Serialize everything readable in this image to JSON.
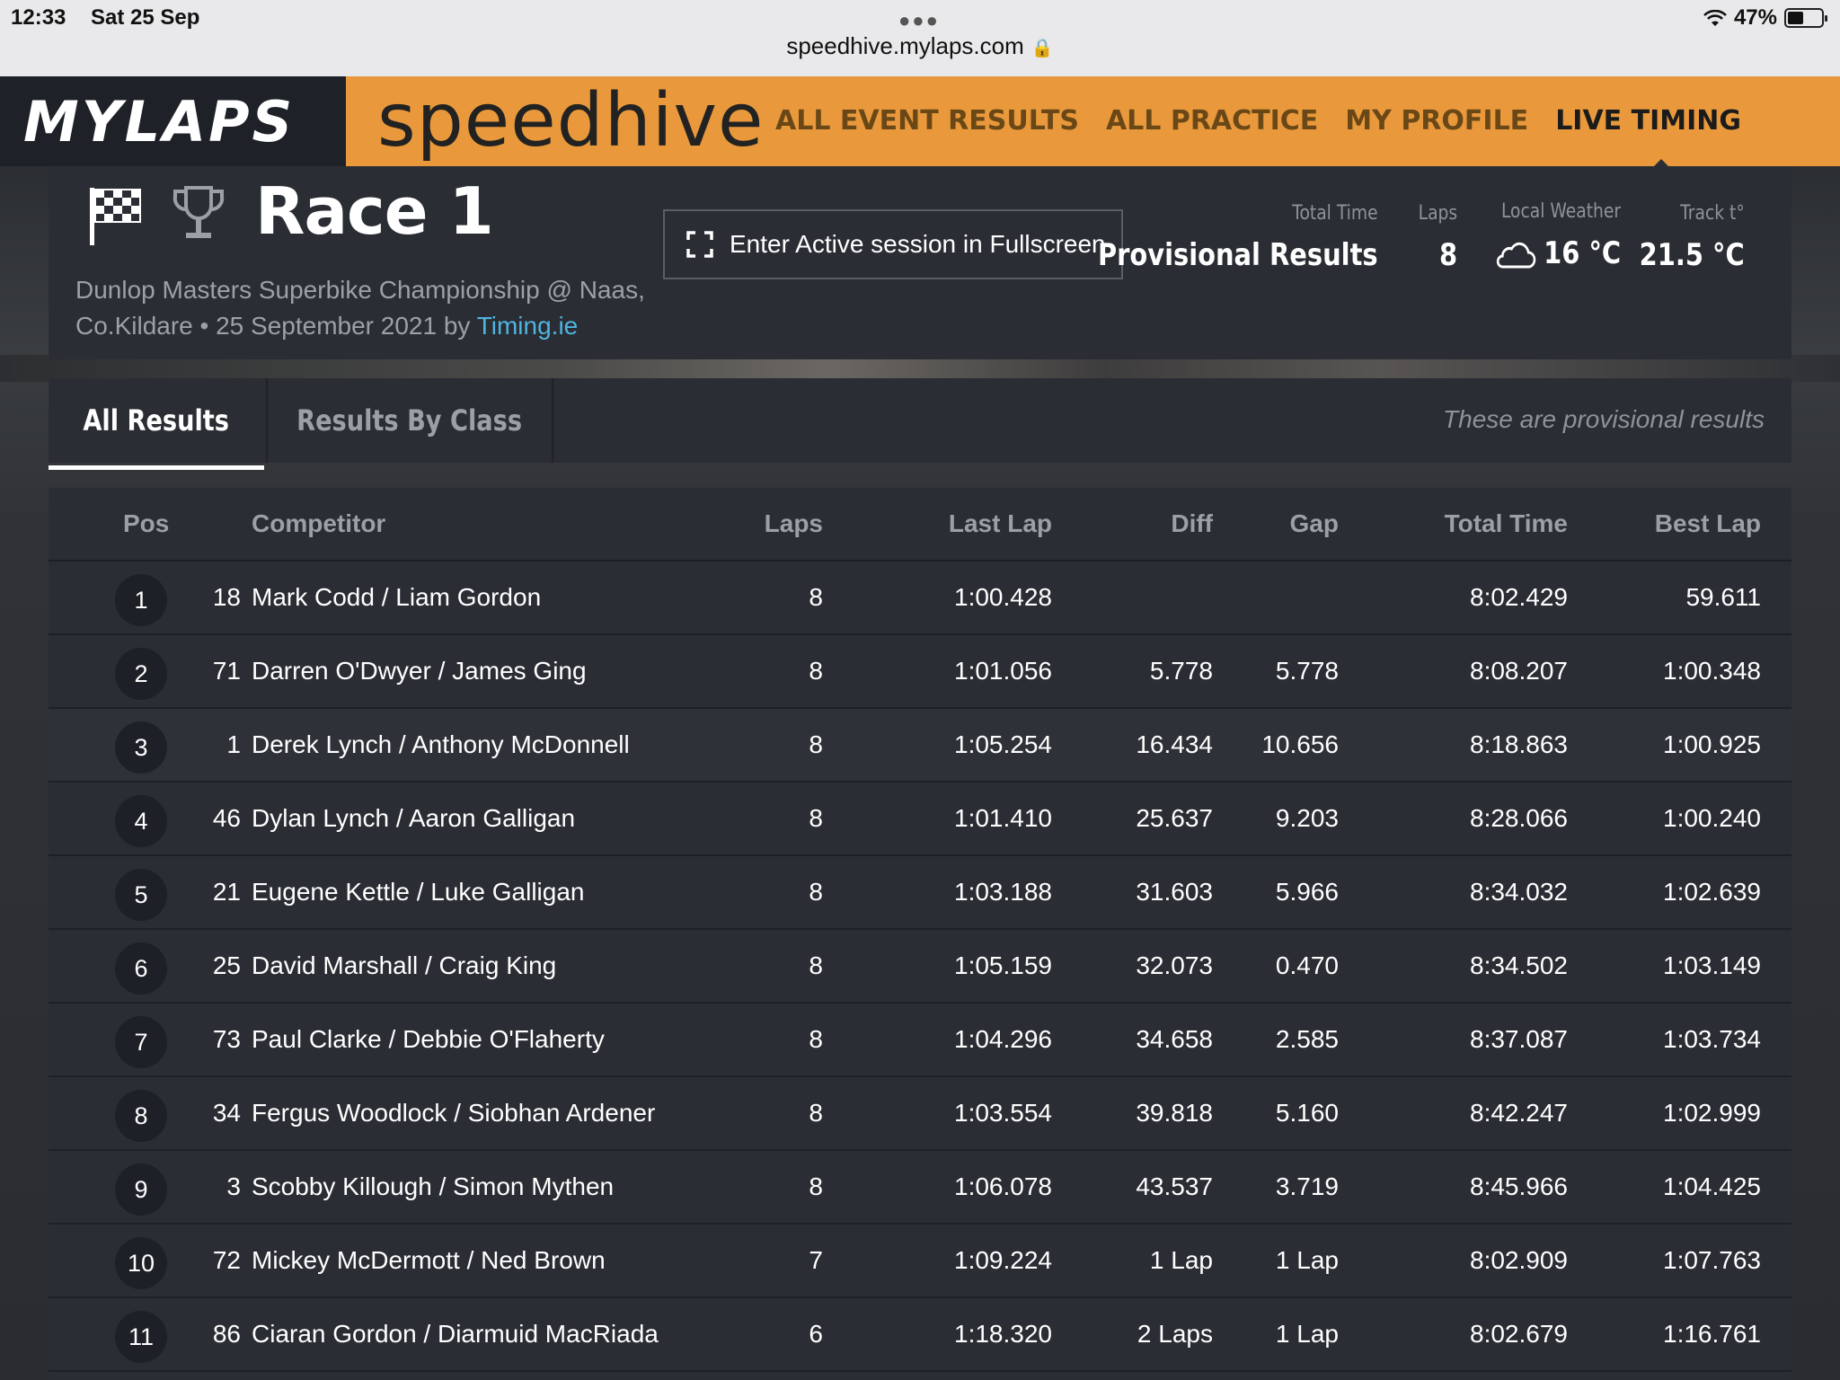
{
  "status_bar": {
    "time": "12:33",
    "date": "Sat 25 Sep",
    "url": "speedhive.mylaps.com",
    "battery": "47%",
    "battery_level": 0.47
  },
  "header": {
    "brand_left": "MYLAPS",
    "brand_right": "speedhive",
    "nav": [
      "ALL EVENT RESULTS",
      "ALL PRACTICE",
      "MY PROFILE",
      "LIVE TIMING"
    ],
    "active_nav": "LIVE TIMING",
    "accent_color": "#e9993b"
  },
  "race": {
    "title": "Race 1",
    "subtitle": "Dunlop Masters Superbike Championship @ Naas, Co.Kildare • 25 September 2021 by",
    "organizer_link": "Timing.ie",
    "fullscreen_button": "Enter Active session in Fullscreen",
    "stats": {
      "total_time_label": "Total Time",
      "total_time_value": "Provisional Results",
      "laps_label": "Laps",
      "laps_value": "8",
      "weather_label": "Local Weather",
      "weather_value": "16 °C",
      "track_label": "Track t°",
      "track_value": "21.5 °C"
    }
  },
  "tabs": {
    "all": "All Results",
    "by_class": "Results By Class",
    "note": "These are provisional results"
  },
  "table": {
    "columns": {
      "pos": "Pos",
      "competitor": "Competitor",
      "laps": "Laps",
      "last_lap": "Last Lap",
      "diff": "Diff",
      "gap": "Gap",
      "total_time": "Total Time",
      "best_lap": "Best Lap"
    },
    "rows": [
      {
        "pos": "1",
        "num": "18",
        "name": "Mark Codd / Liam Gordon",
        "laps": "8",
        "last": "1:00.428",
        "diff": "",
        "gap": "",
        "total": "8:02.429",
        "best": "59.611"
      },
      {
        "pos": "2",
        "num": "71",
        "name": "Darren O'Dwyer / James Ging",
        "laps": "8",
        "last": "1:01.056",
        "diff": "5.778",
        "gap": "5.778",
        "total": "8:08.207",
        "best": "1:00.348"
      },
      {
        "pos": "3",
        "num": "1",
        "name": "Derek Lynch / Anthony McDonnell",
        "laps": "8",
        "last": "1:05.254",
        "diff": "16.434",
        "gap": "10.656",
        "total": "8:18.863",
        "best": "1:00.925"
      },
      {
        "pos": "4",
        "num": "46",
        "name": "Dylan Lynch / Aaron Galligan",
        "laps": "8",
        "last": "1:01.410",
        "diff": "25.637",
        "gap": "9.203",
        "total": "8:28.066",
        "best": "1:00.240"
      },
      {
        "pos": "5",
        "num": "21",
        "name": "Eugene Kettle / Luke Galligan",
        "laps": "8",
        "last": "1:03.188",
        "diff": "31.603",
        "gap": "5.966",
        "total": "8:34.032",
        "best": "1:02.639"
      },
      {
        "pos": "6",
        "num": "25",
        "name": "David Marshall / Craig King",
        "laps": "8",
        "last": "1:05.159",
        "diff": "32.073",
        "gap": "0.470",
        "total": "8:34.502",
        "best": "1:03.149"
      },
      {
        "pos": "7",
        "num": "73",
        "name": "Paul Clarke / Debbie O'Flaherty",
        "laps": "8",
        "last": "1:04.296",
        "diff": "34.658",
        "gap": "2.585",
        "total": "8:37.087",
        "best": "1:03.734"
      },
      {
        "pos": "8",
        "num": "34",
        "name": "Fergus Woodlock / Siobhan Ardener",
        "laps": "8",
        "last": "1:03.554",
        "diff": "39.818",
        "gap": "5.160",
        "total": "8:42.247",
        "best": "1:02.999"
      },
      {
        "pos": "9",
        "num": "3",
        "name": "Scobby Killough / Simon Mythen",
        "laps": "8",
        "last": "1:06.078",
        "diff": "43.537",
        "gap": "3.719",
        "total": "8:45.966",
        "best": "1:04.425"
      },
      {
        "pos": "10",
        "num": "72",
        "name": "Mickey McDermott / Ned Brown",
        "laps": "7",
        "last": "1:09.224",
        "diff": "1 Lap",
        "gap": "1 Lap",
        "total": "8:02.909",
        "best": "1:07.763"
      },
      {
        "pos": "11",
        "num": "86",
        "name": "Ciaran Gordon / Diarmuid MacRiada",
        "laps": "6",
        "last": "1:18.320",
        "diff": "2 Laps",
        "gap": "1 Lap",
        "total": "8:02.679",
        "best": "1:16.761"
      }
    ]
  }
}
